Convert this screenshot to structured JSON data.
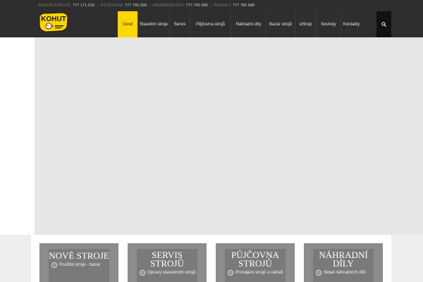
{
  "topbar": {
    "items": [
      {
        "label": "SERVIS STROJŮ:",
        "number": "777 171 015"
      },
      {
        "label": "PŮJČOVNA:",
        "number": "777 765 599"
      },
      {
        "label": "NÁHRADNÍ DÍLY:",
        "number": "777 765 585"
      },
      {
        "label": "PRODEJ:",
        "number": "777 765 588"
      }
    ]
  },
  "logo": {
    "text": "KOHUT",
    "alt": "Kohut logo"
  },
  "nav": {
    "items": [
      {
        "label": "Úvod",
        "active": true
      },
      {
        "label": "Stavební stroje",
        "active": false
      },
      {
        "label": "Servis",
        "active": false
      },
      {
        "label": "Půjčovna strojů",
        "active": false
      },
      {
        "label": "Náhradní díly",
        "active": false
      },
      {
        "label": "Bazar strojů",
        "active": false
      },
      {
        "label": "eShop",
        "active": false
      },
      {
        "label": "Novinky",
        "active": false
      },
      {
        "label": "Kontakty",
        "active": false
      }
    ],
    "search_icon": "search-icon"
  },
  "boxes": [
    {
      "title_lines": [
        "NOVÉ STROJE"
      ],
      "link": "Použité stroje - bazar"
    },
    {
      "title_lines": [
        "SERVIS",
        "STROJŮ"
      ],
      "link": "Opravy stavebních strojů"
    },
    {
      "title_lines": [
        "PŮJČOVNA",
        "STROJŮ"
      ],
      "link": "Pronájem strojů a nářadí"
    },
    {
      "title_lines": [
        "NÁHRADNÍ",
        "DÍLY"
      ],
      "link": "Sklad náhradních dílů"
    }
  ],
  "colors": {
    "accent": "#ffd600",
    "header_bg": "#2e2e2e",
    "slider_bg": "#e6e6e6",
    "box_bg": "#7a7a7a"
  }
}
